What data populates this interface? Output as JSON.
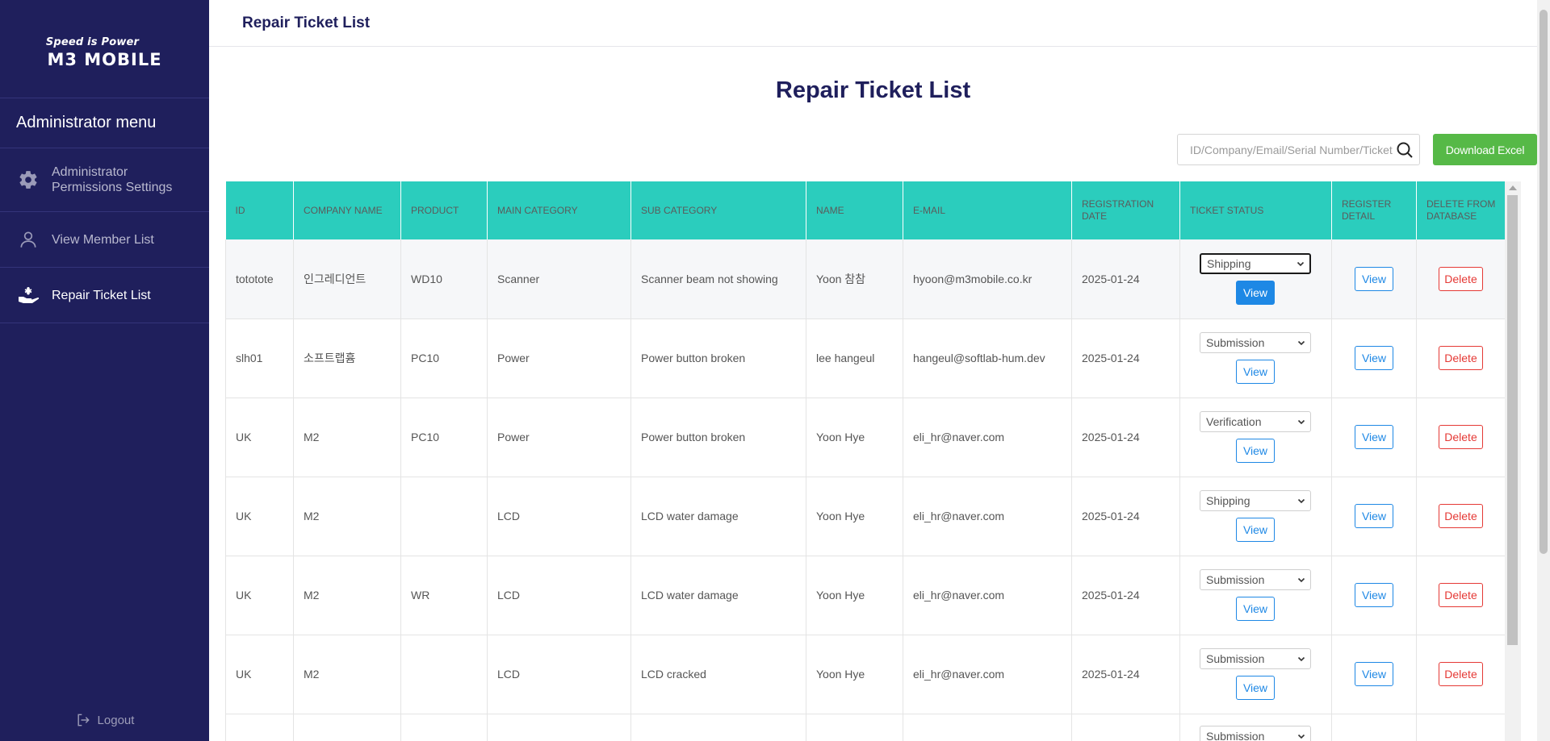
{
  "sidebar": {
    "tagline": "Speed is Power",
    "brand": "M3 MOBILE",
    "menu_title": "Administrator menu",
    "items": [
      {
        "label": "Administrator Permissions Settings",
        "icon": "gear-icon"
      },
      {
        "label": "View Member List",
        "icon": "user-icon"
      },
      {
        "label": "Repair Ticket List",
        "icon": "repair-icon"
      }
    ],
    "logout": "Logout"
  },
  "topbar": {
    "title": "Repair Ticket List"
  },
  "main": {
    "title": "Repair Ticket List",
    "search_placeholder": "ID/Company/Email/Serial Number/Ticket",
    "download_label": "Download Excel"
  },
  "table": {
    "headers": [
      "ID",
      "COMPANY NAME",
      "PRODUCT",
      "MAIN CATEGORY",
      "SUB CATEGORY",
      "NAME",
      "E-MAIL",
      "REGISTRATION DATE",
      "TICKET STATUS",
      "REGISTER DETAIL",
      "DELETE FROM DATABASE"
    ],
    "rows": [
      {
        "id": "tototote",
        "company": "인그레디언트",
        "product": "WD10",
        "main": "Scanner",
        "sub": "Scanner beam not showing",
        "name": "Yoon 참참",
        "email": "hyoon@m3mobile.co.kr",
        "date": "2025-01-24",
        "status": "Shipping",
        "view": "View",
        "delete": "Delete"
      },
      {
        "id": "slh01",
        "company": "소프트랩흄",
        "product": "PC10",
        "main": "Power",
        "sub": "Power button broken",
        "name": "lee hangeul",
        "email": "hangeul@softlab-hum.dev",
        "date": "2025-01-24",
        "status": "Submission",
        "view": "View",
        "delete": "Delete"
      },
      {
        "id": "UK",
        "company": "M2",
        "product": "PC10",
        "main": "Power",
        "sub": "Power button broken",
        "name": "Yoon Hye",
        "email": "eli_hr@naver.com",
        "date": "2025-01-24",
        "status": "Verification",
        "view": "View",
        "delete": "Delete"
      },
      {
        "id": "UK",
        "company": "M2",
        "product": "",
        "main": "LCD",
        "sub": "LCD water damage",
        "name": "Yoon Hye",
        "email": "eli_hr@naver.com",
        "date": "2025-01-24",
        "status": "Shipping",
        "view": "View",
        "delete": "Delete"
      },
      {
        "id": "UK",
        "company": "M2",
        "product": "WR",
        "main": "LCD",
        "sub": "LCD water damage",
        "name": "Yoon Hye",
        "email": "eli_hr@naver.com",
        "date": "2025-01-24",
        "status": "Submission",
        "view": "View",
        "delete": "Delete"
      },
      {
        "id": "UK",
        "company": "M2",
        "product": "",
        "main": "LCD",
        "sub": "LCD cracked",
        "name": "Yoon Hye",
        "email": "eli_hr@naver.com",
        "date": "2025-01-24",
        "status": "Submission",
        "view": "View",
        "delete": "Delete"
      }
    ],
    "partial_status": "Submission"
  },
  "colors": {
    "sidebar": "#1f1f5c",
    "header": "#2bcdbd",
    "accent": "#1e88e5",
    "danger": "#e53935",
    "excel": "#56b947"
  }
}
